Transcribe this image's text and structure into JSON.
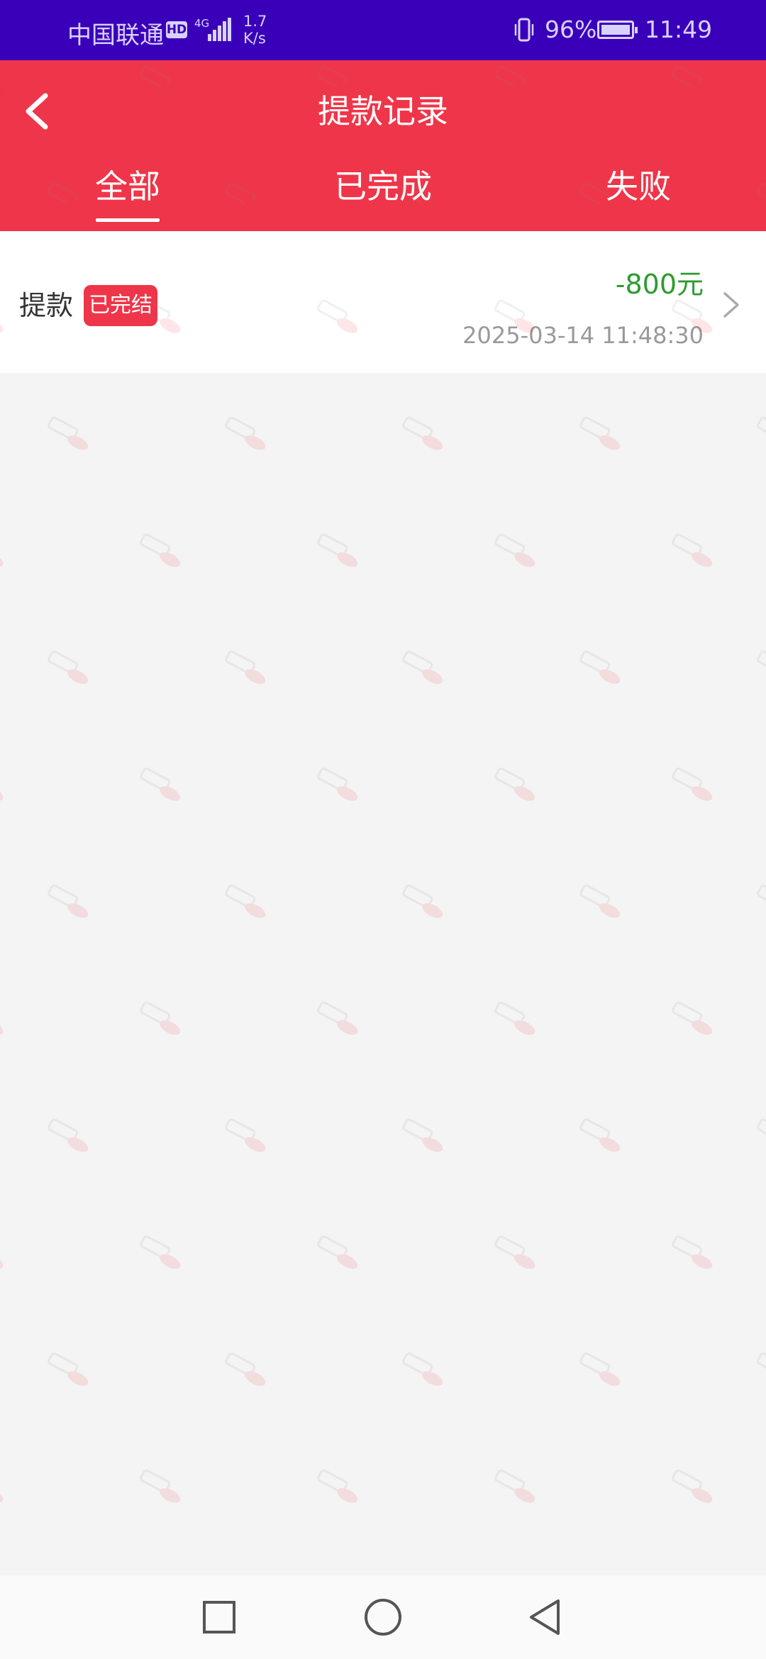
{
  "status_bar": {
    "carrier": "中国联通",
    "hd": "HD",
    "network_type": "4G",
    "speed_value": "1.7",
    "speed_unit": "K/s",
    "battery_percent": "96%",
    "time": "11:49"
  },
  "header": {
    "title": "提款记录",
    "back_icon": "chevron-left-icon",
    "background_color": "#ef3549"
  },
  "tabs": [
    {
      "label": "全部",
      "active": true
    },
    {
      "label": "已完成",
      "active": false
    },
    {
      "label": "失败",
      "active": false
    }
  ],
  "records": [
    {
      "type": "提款",
      "status": "已完结",
      "amount": "-800元",
      "time": "2025-03-14 11:48:30"
    }
  ],
  "colors": {
    "status_bar": "#3a00b9",
    "accent": "#ef3549",
    "amount": "#2e9c2e",
    "background": "#f4f4f4"
  },
  "nav_bar": {
    "recents_icon": "square-icon",
    "home_icon": "circle-icon",
    "back_icon": "triangle-back-icon"
  }
}
